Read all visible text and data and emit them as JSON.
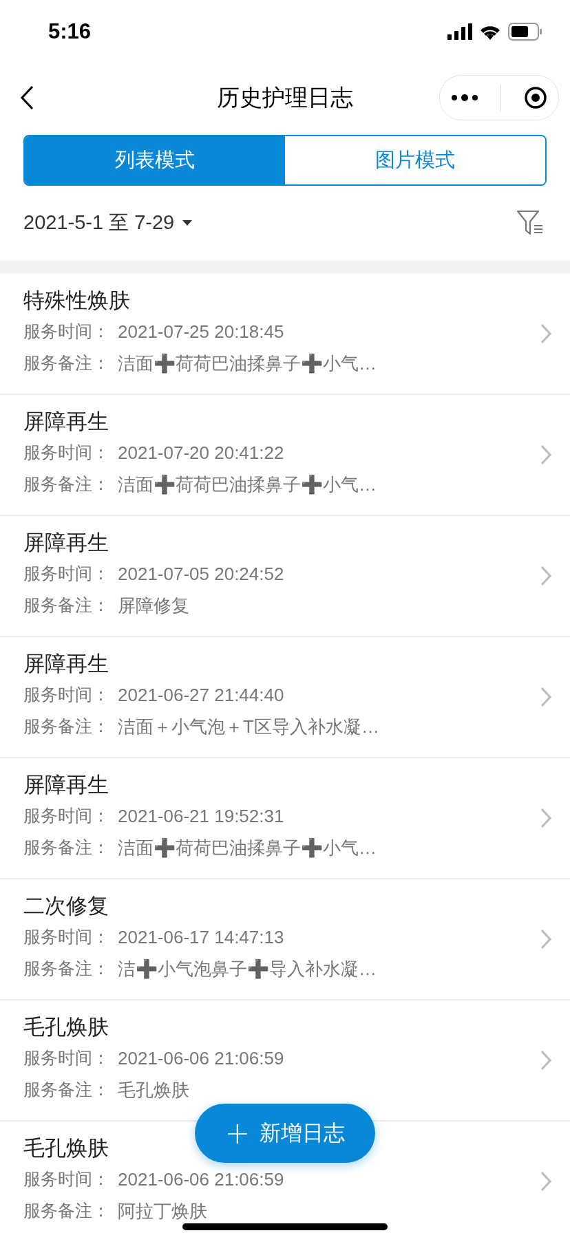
{
  "status_bar": {
    "time": "5:16"
  },
  "nav": {
    "title": "历史护理日志"
  },
  "tabs": [
    {
      "label": "列表模式",
      "selected": true
    },
    {
      "label": "图片模式",
      "selected": false
    }
  ],
  "date_filter": {
    "range": "2021-5-1 至 7-29"
  },
  "records": [
    {
      "title": "特殊性焕肤",
      "time_label": "服务时间：",
      "time": "2021-07-25 20:18:45",
      "note_label": "服务备注：",
      "note": "洁面➕荷荷巴油揉鼻子➕小气…"
    },
    {
      "title": "屏障再生",
      "time_label": "服务时间：",
      "time": "2021-07-20 20:41:22",
      "note_label": "服务备注：",
      "note": "洁面➕荷荷巴油揉鼻子➕小气…"
    },
    {
      "title": "屏障再生",
      "time_label": "服务时间：",
      "time": "2021-07-05 20:24:52",
      "note_label": "服务备注：",
      "note": "屏障修复"
    },
    {
      "title": "屏障再生",
      "time_label": "服务时间：",
      "time": "2021-06-27 21:44:40",
      "note_label": "服务备注：",
      "note": "洁面＋小气泡＋T区导入补水凝…"
    },
    {
      "title": "屏障再生",
      "time_label": "服务时间：",
      "time": "2021-06-21 19:52:31",
      "note_label": "服务备注：",
      "note": "洁面➕荷荷巴油揉鼻子➕小气…"
    },
    {
      "title": "二次修复",
      "time_label": "服务时间：",
      "time": "2021-06-17 14:47:13",
      "note_label": "服务备注：",
      "note": "洁➕小气泡鼻子➕导入补水凝…"
    },
    {
      "title": "毛孔焕肤",
      "time_label": "服务时间：",
      "time": "2021-06-06 21:06:59",
      "note_label": "服务备注：",
      "note": "毛孔焕肤"
    },
    {
      "title": "毛孔焕肤",
      "time_label": "服务时间：",
      "time": "2021-06-06 21:06:59",
      "note_label": "服务备注：",
      "note": "阿拉丁焕肤"
    }
  ],
  "add_button": {
    "label": "新增日志",
    "icon": "+"
  }
}
